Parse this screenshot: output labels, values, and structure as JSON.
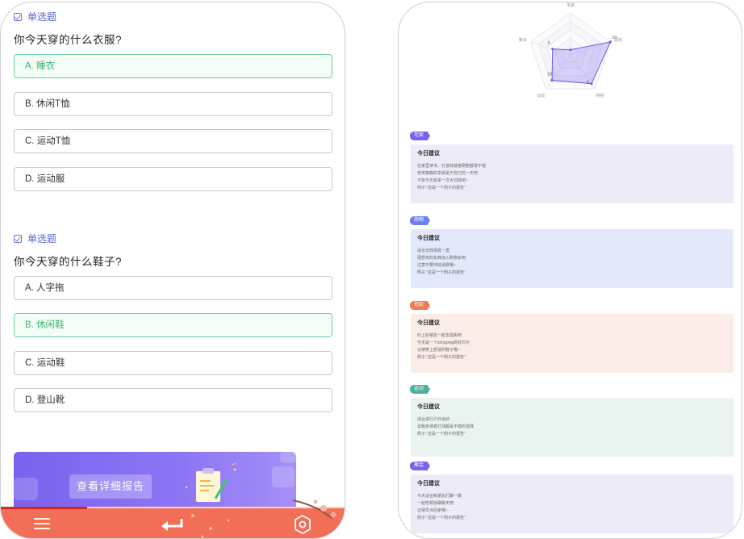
{
  "quiz": {
    "questions": [
      {
        "tag": "单选题",
        "title": "你今天穿的什么衣服?",
        "options": [
          "A. 睡衣",
          "B. 休闲T恤",
          "C. 运动T恤",
          "D. 运动服"
        ],
        "selected_index": 0
      },
      {
        "tag": "单选题",
        "title": "你今天穿的什么鞋子?",
        "options": [
          "A. 人字拖",
          "B. 休闲鞋",
          "C. 运动鞋",
          "D. 登山靴"
        ],
        "selected_index": 1
      }
    ],
    "report_button": "查看详细报告",
    "progress_fraction": 0.25
  },
  "bottom_bar": {
    "icons": [
      "menu-icon",
      "return-icon",
      "settings-icon"
    ]
  },
  "colors": {
    "accent_purple": "#7a62ef",
    "selected_green": "#3ab86c",
    "bottom_bar": "#f36e56",
    "card_1": "#eeebf8",
    "card_2": "#e3e9fa",
    "card_3": "#fbece7",
    "card_4": "#e9f4f1",
    "card_5": "#eeebf8"
  },
  "radar": {
    "axis_labels": [
      "宅家",
      "逛街",
      "购物",
      "运动",
      "聚会"
    ],
    "value_labels": [
      "10",
      "8",
      "10",
      "5"
    ]
  },
  "report": {
    "sections": [
      {
        "badge": "宅家",
        "badge_color": "#7a62ef",
        "title": "今日建议",
        "lines": [
          "在家里读书、打游戏或者刷剧都很不错",
          "安安静静的享受属于自己的一天吧",
          "不如今天就来一次大扫除吧~",
          "例子:“这是一个例子的报告”"
        ]
      },
      {
        "badge": "购物",
        "badge_color": "#6b7ff0",
        "title": "今日建议",
        "lines": [
          "适合去商场逛一逛",
          "把想买的东西加入购物车吧",
          "注意不要冲动消费哦~",
          "例子:“这是一个例子的报告”"
        ]
      },
      {
        "badge": "逛街",
        "badge_color": "#f07a52",
        "title": "今日建议",
        "lines": [
          "约上好朋友一起去逛街吧",
          "今天是一个shopping的好日子",
          "记得穿上舒适的鞋子哦~",
          "例子:“这是一个例子的报告”"
        ]
      },
      {
        "badge": "运动",
        "badge_color": "#4fb0a0",
        "title": "今日建议",
        "lines": [
          "适合进行户外运动",
          "去跑步或者打球都是不错的选择",
          "例子:“这是一个例子的报告”"
        ]
      },
      {
        "badge": "聚会",
        "badge_color": "#7a62ef",
        "title": "今日建议",
        "lines": [
          "今天适合和朋友们聚一聚",
          "一起吃顿饭聊聊天吧",
          "记得早点回家哦~",
          "例子:“这是一个例子的报告”"
        ]
      }
    ]
  }
}
